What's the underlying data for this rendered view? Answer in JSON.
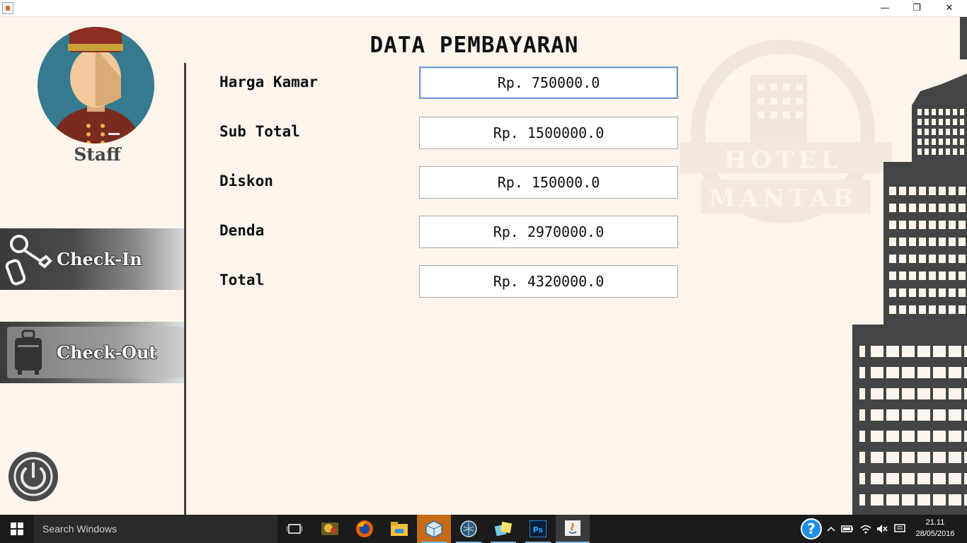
{
  "window": {
    "minimize": "—",
    "maximize": "❐",
    "close": "✕"
  },
  "sidebar": {
    "user_label": "Staff",
    "checkin_label": "Check-In",
    "checkout_label": "Check-Out"
  },
  "main": {
    "title": "DATA PEMBAYARAN",
    "rows": [
      {
        "label": "Harga Kamar",
        "value": "Rp. 750000.0"
      },
      {
        "label": "Sub Total",
        "value": "Rp. 1500000.0"
      },
      {
        "label": "Diskon",
        "value": "Rp. 150000.0"
      },
      {
        "label": "Denda",
        "value": "Rp. 2970000.0"
      },
      {
        "label": "Total",
        "value": "Rp. 4320000.0"
      }
    ]
  },
  "logo": {
    "line1": "HOTEL",
    "line2": "MANTAB"
  },
  "taskbar": {
    "search_placeholder": "Search Windows",
    "time": "21.11",
    "date": "28/05/2016"
  },
  "colors": {
    "background": "#fdf5ec",
    "sidebar_button": "#3a3a3a",
    "building": "#444444",
    "taskbar": "#1b1b1b"
  }
}
